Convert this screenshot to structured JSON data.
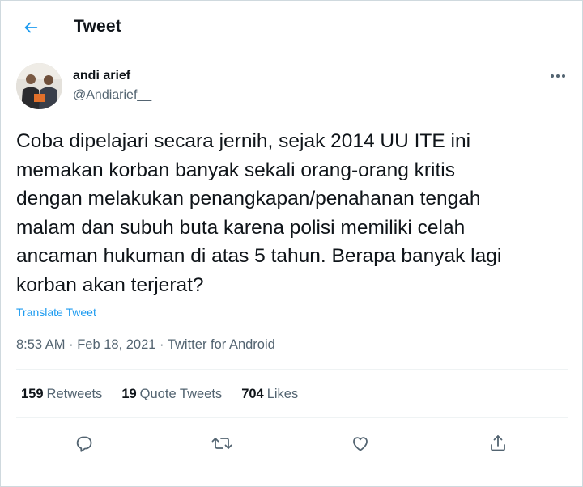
{
  "header": {
    "title": "Tweet",
    "back_icon": "arrow-left-icon"
  },
  "author": {
    "name": "andi arief",
    "handle": "@Andiarief__",
    "more_icon": "more-horizontal-icon"
  },
  "tweet": {
    "text": "Coba dipelajari secara jernih, sejak 2014 UU ITE ini\nmemakan korban banyak sekali orang-orang kritis\ndengan melakukan penangkapan/penahanan tengah\nmalam dan subuh buta karena polisi memiliki celah\nancaman hukuman di atas 5 tahun. Berapa banyak lagi\nkorban akan terjerat?",
    "translate_label": "Translate Tweet",
    "time": "8:53 AM",
    "sep1": " · ",
    "date": "Feb 18, 2021",
    "sep2": " · ",
    "source": "Twitter for Android"
  },
  "stats": {
    "retweets_count": "159",
    "retweets_label": "Retweets",
    "quotes_count": "19",
    "quotes_label": "Quote Tweets",
    "likes_count": "704",
    "likes_label": "Likes"
  },
  "actions": [
    "reply-icon",
    "retweet-icon",
    "like-icon",
    "share-icon"
  ],
  "colors": {
    "accent": "#1d9bf0",
    "text": "#0f1419",
    "muted": "#536471",
    "border": "#eff3f4"
  }
}
